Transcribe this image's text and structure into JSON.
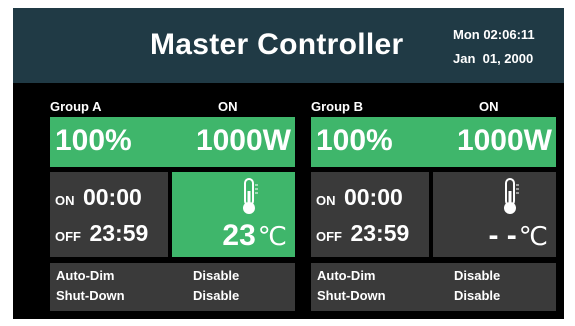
{
  "header": {
    "title": "Master Controller",
    "day_time": "Mon 02:06:11",
    "date": "Jan  01, 2000"
  },
  "colors": {
    "header_bg": "#203a45",
    "active_green": "#3fb66b",
    "panel_gray": "#3a3a3a",
    "screen_bg": "#000000"
  },
  "groups": [
    {
      "name": "Group A",
      "status": "ON",
      "percent": "100%",
      "watts": "1000W",
      "timer": {
        "on_label": "ON",
        "on_time": "00:00",
        "off_label": "OFF",
        "off_time": "23:59"
      },
      "temperature": {
        "value": "23",
        "unit": "℃",
        "icon": "thermometer-icon"
      },
      "settings": [
        {
          "label": "Auto-Dim",
          "value": "Disable"
        },
        {
          "label": "Shut-Down",
          "value": "Disable"
        }
      ]
    },
    {
      "name": "Group B",
      "status": "ON",
      "percent": "100%",
      "watts": "1000W",
      "timer": {
        "on_label": "ON",
        "on_time": "00:00",
        "off_label": "OFF",
        "off_time": "23:59"
      },
      "temperature": {
        "value": "- -",
        "unit": "℃",
        "icon": "thermometer-icon"
      },
      "settings": [
        {
          "label": "Auto-Dim",
          "value": "Disable"
        },
        {
          "label": "Shut-Down",
          "value": "Disable"
        }
      ]
    }
  ]
}
